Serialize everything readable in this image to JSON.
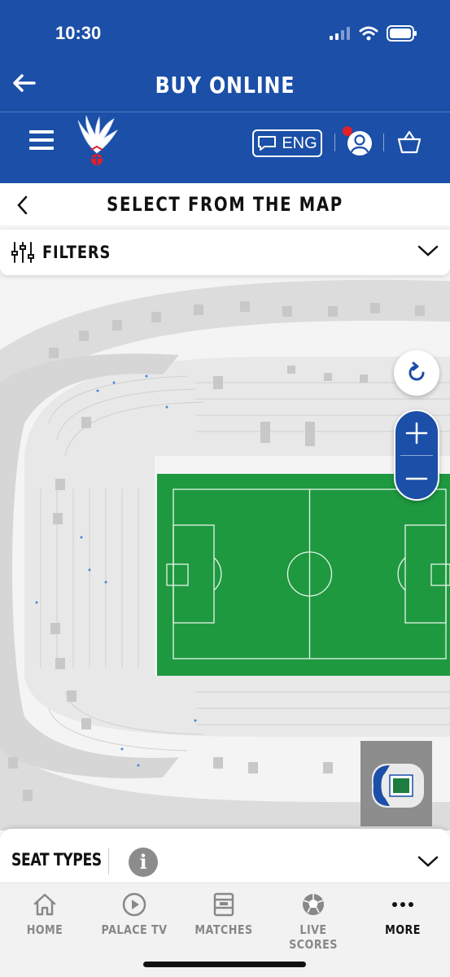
{
  "status": {
    "time": "10:30"
  },
  "header": {
    "title": "BUY ONLINE",
    "lang_label": "ENG"
  },
  "page": {
    "title": "SELECT FROM THE MAP"
  },
  "filters": {
    "label": "FILTERS"
  },
  "seat_types": {
    "label": "SEAT TYPES"
  },
  "tabs": [
    {
      "label": "HOME",
      "icon": "home-icon"
    },
    {
      "label": "PALACE TV",
      "icon": "play-icon"
    },
    {
      "label": "MATCHES",
      "icon": "calendar-icon"
    },
    {
      "label": "LIVE SCORES",
      "icon": "football-icon"
    },
    {
      "label": "MORE",
      "icon": "more-icon"
    }
  ],
  "colors": {
    "brand_blue": "#1b4fa8",
    "pitch_green": "#1e9940",
    "notification_red": "#e2202a"
  }
}
